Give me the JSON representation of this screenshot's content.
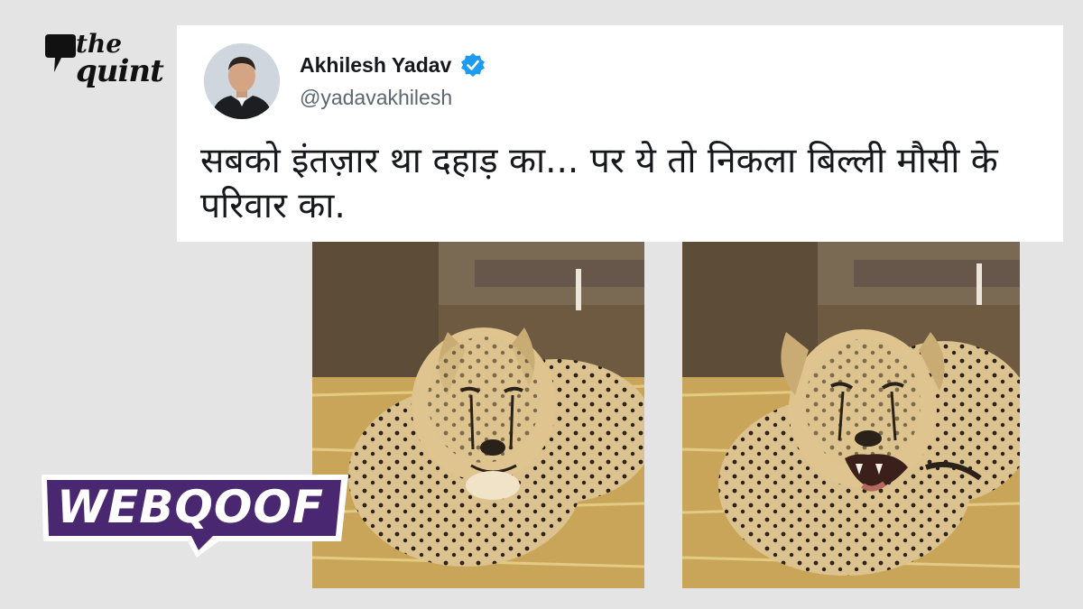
{
  "brand": {
    "logo_line1": "the",
    "logo_line2": "quint",
    "badge_label": "WEBQOOF"
  },
  "tweet": {
    "author_name": "Akhilesh Yadav",
    "handle": "@yadavakhilesh",
    "text": "सबको इंतज़ार था दहाड़ का... पर ये तो निकला बिल्ली मौसी के परिवार का.",
    "verified": true
  },
  "frames": [
    {
      "subject": "cheetah lying on straw, mouth closed"
    },
    {
      "subject": "cheetah lying on straw, mouth open"
    }
  ],
  "colors": {
    "page_background": "#e4e4e4",
    "card_background": "#ffffff",
    "verified_blue": "#1d9bf0",
    "badge_purple": "#4a2771"
  }
}
